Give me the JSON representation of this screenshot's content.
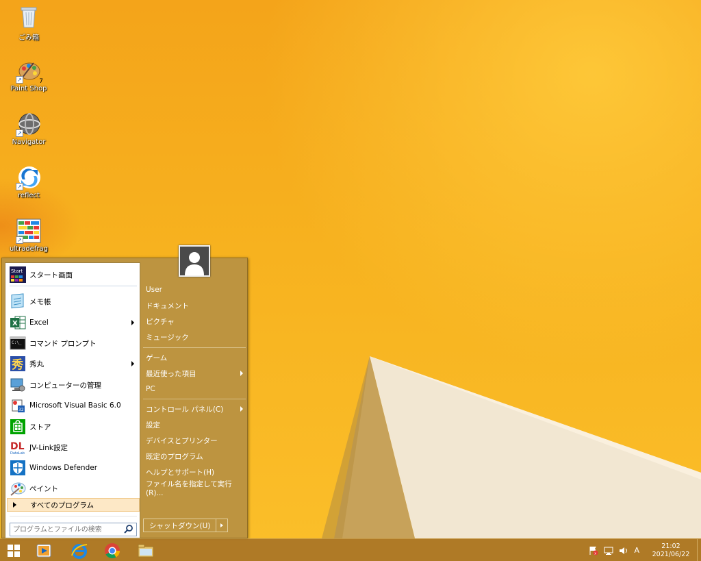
{
  "desktop": {
    "icons": [
      {
        "label": "ごみ箱",
        "icon": "recycle-bin-icon"
      },
      {
        "label": "Paint Shop",
        "icon": "paint-shop-icon",
        "badge": "7"
      },
      {
        "label": "Navigator",
        "icon": "navigator-icon"
      },
      {
        "label": "reflect",
        "icon": "reflect-icon"
      },
      {
        "label": "ultradefrag",
        "icon": "ultradefrag-icon"
      }
    ]
  },
  "start_menu": {
    "pinned": [
      {
        "label": "スタート画面",
        "icon": "start-screen-icon",
        "icon_text": "Start"
      }
    ],
    "programs": [
      {
        "label": "メモ帳",
        "icon": "notepad-icon",
        "submenu": false
      },
      {
        "label": "Excel",
        "icon": "excel-icon",
        "submenu": true
      },
      {
        "label": "コマンド プロンプト",
        "icon": "command-prompt-icon",
        "submenu": false
      },
      {
        "label": "秀丸",
        "icon": "hidemaru-icon",
        "submenu": true
      },
      {
        "label": "コンピューターの管理",
        "icon": "computer-management-icon",
        "submenu": false
      },
      {
        "label": "Microsoft Visual Basic 6.0",
        "icon": "visual-basic-icon",
        "submenu": false
      },
      {
        "label": "ストア",
        "icon": "store-icon",
        "submenu": false
      },
      {
        "label": "JV-Link設定",
        "icon": "jv-link-icon",
        "submenu": false
      },
      {
        "label": "Windows Defender",
        "icon": "windows-defender-icon",
        "submenu": false
      },
      {
        "label": "ペイント",
        "icon": "paint-icon",
        "submenu": false
      }
    ],
    "all_programs": "すべてのプログラム",
    "search_placeholder": "プログラムとファイルの検索",
    "right_items": [
      {
        "label": "User",
        "submenu": false
      },
      {
        "label": "ドキュメント",
        "submenu": false
      },
      {
        "label": "ピクチャ",
        "submenu": false
      },
      {
        "label": "ミュージック",
        "submenu": false
      },
      {
        "label": "ゲーム",
        "submenu": false
      },
      {
        "label": "最近使った項目",
        "submenu": true
      },
      {
        "label": "PC",
        "submenu": false
      },
      {
        "label": "コントロール パネル(C)",
        "submenu": true
      },
      {
        "label": "設定",
        "submenu": false
      },
      {
        "label": "デバイスとプリンター",
        "submenu": false
      },
      {
        "label": "既定のプログラム",
        "submenu": false
      },
      {
        "label": "ヘルプとサポート(H)",
        "submenu": false
      },
      {
        "label": "ファイル名を指定して実行(R)...",
        "submenu": false
      }
    ],
    "shutdown_label": "シャットダウン(U)"
  },
  "taskbar": {
    "buttons": [
      "start-button",
      "media-player-button",
      "internet-explorer-button",
      "chrome-button",
      "file-explorer-button"
    ],
    "tray": {
      "ime": "A",
      "time": "21:02",
      "date": "2021/06/22"
    }
  },
  "colors": {
    "wallpaper": "#f4ad1c",
    "start_menu_bg": "#bd9440",
    "taskbar": "#a87426"
  }
}
